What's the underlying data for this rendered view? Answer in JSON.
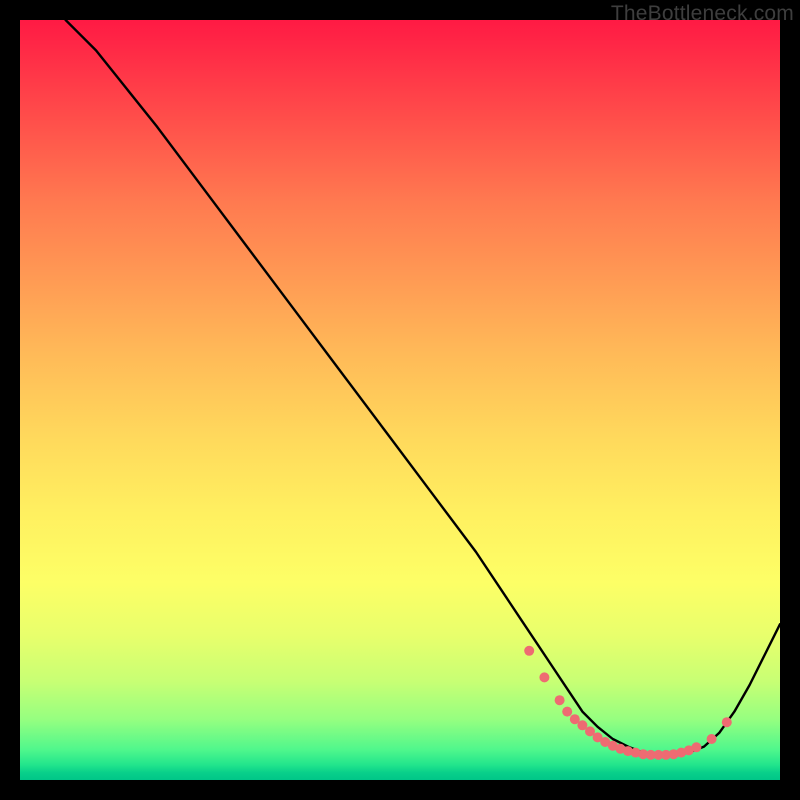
{
  "watermark": "TheBottleneck.com",
  "colors": {
    "background": "#000000",
    "gradient_top": "#ff1a44",
    "gradient_bottom": "#00c688",
    "curve_stroke": "#000000",
    "dot_fill": "#ee6b72"
  },
  "chart_data": {
    "type": "line",
    "title": "",
    "xlabel": "",
    "ylabel": "",
    "xlim": [
      0,
      100
    ],
    "ylim": [
      0,
      100
    ],
    "series": [
      {
        "name": "bottleneck-curve",
        "x": [
          6,
          8,
          10,
          14,
          18,
          24,
          30,
          36,
          42,
          48,
          54,
          60,
          64,
          66,
          68,
          70,
          72,
          74,
          76,
          78,
          80,
          82,
          84,
          86,
          88,
          90,
          92,
          94,
          96,
          98,
          100
        ],
        "y": [
          100,
          98,
          96,
          91,
          86,
          78,
          70,
          62,
          54,
          46,
          38,
          30,
          24,
          21,
          18,
          15,
          12,
          9,
          7,
          5.4,
          4.4,
          3.6,
          3.3,
          3.3,
          3.6,
          4.4,
          6.2,
          9,
          12.5,
          16.5,
          20.5
        ]
      }
    ],
    "dots": {
      "comment": "coral dots clustered at the trough of the curve",
      "x": [
        67,
        69,
        71,
        72,
        73,
        74,
        75,
        76,
        77,
        78,
        79,
        80,
        81,
        82,
        83,
        84,
        85,
        86,
        87,
        88,
        89,
        91,
        93
      ],
      "y": [
        17,
        13.5,
        10.5,
        9.0,
        8.0,
        7.2,
        6.4,
        5.6,
        5.0,
        4.5,
        4.1,
        3.8,
        3.6,
        3.4,
        3.3,
        3.3,
        3.3,
        3.4,
        3.6,
        3.9,
        4.3,
        5.4,
        7.6
      ]
    }
  }
}
